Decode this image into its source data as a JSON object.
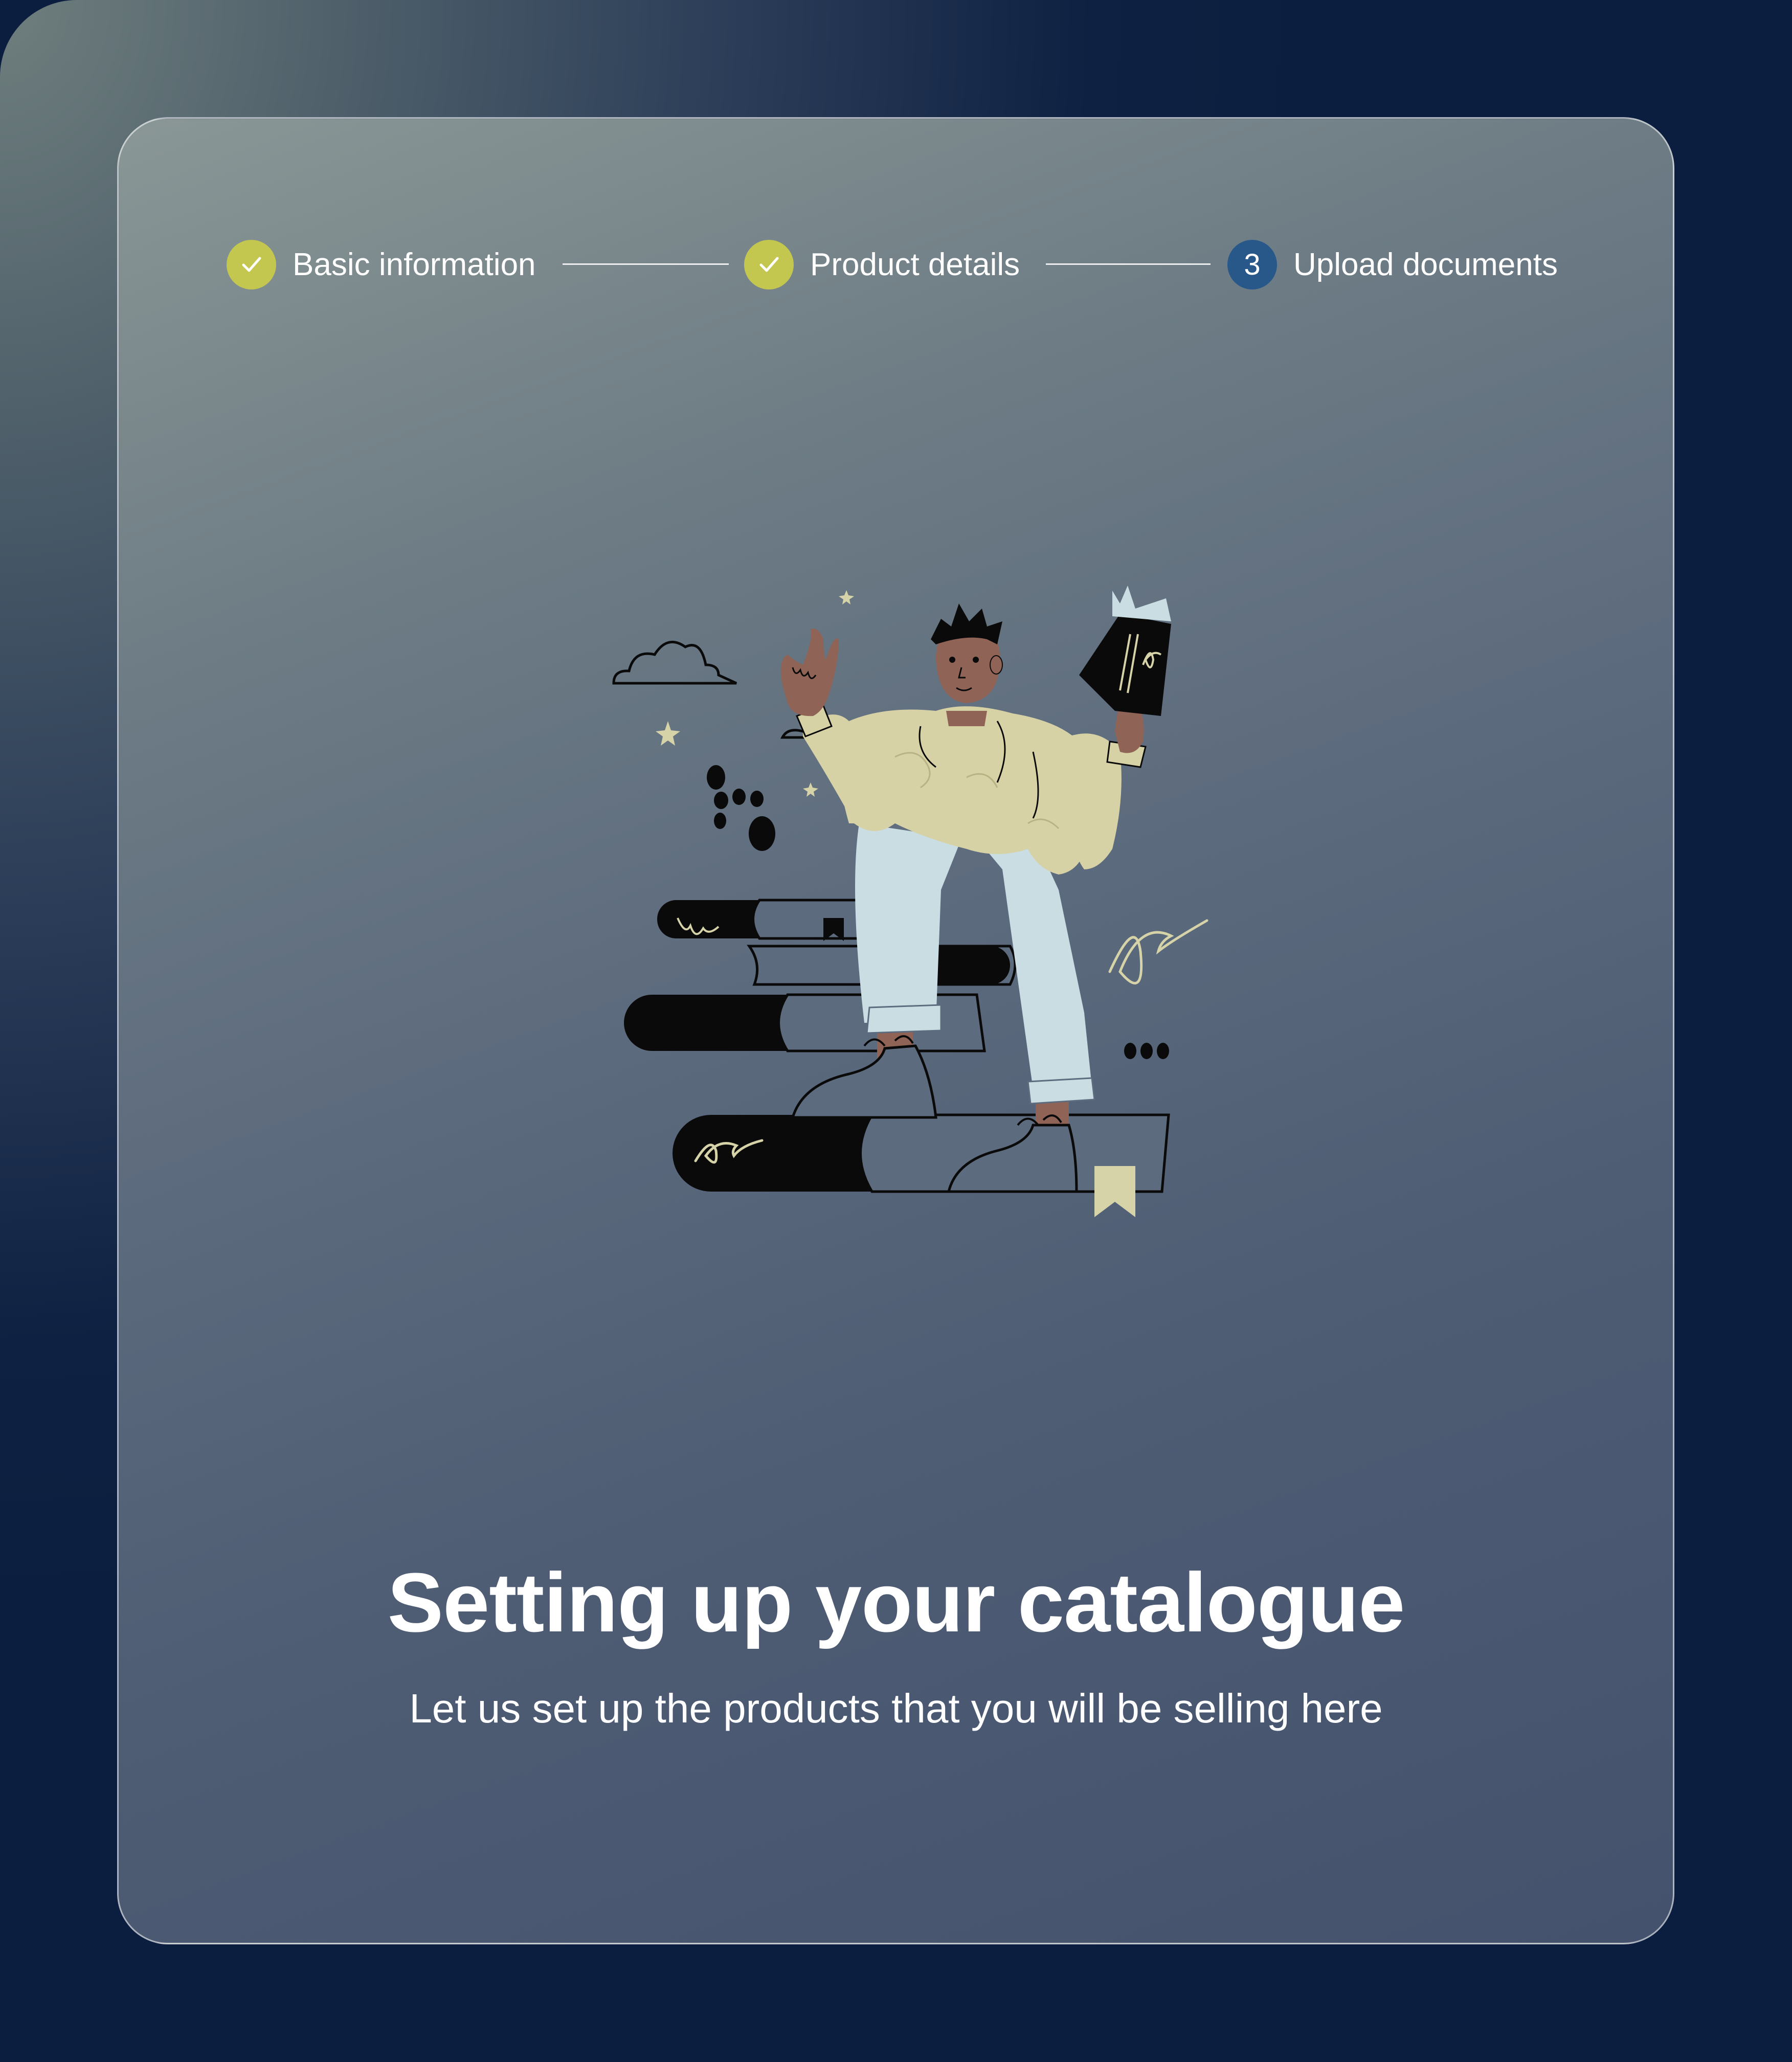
{
  "stepper": {
    "steps": [
      {
        "label": "Basic information",
        "status": "completed",
        "icon": "check-icon"
      },
      {
        "label": "Product details",
        "status": "completed",
        "icon": "check-icon"
      },
      {
        "label": "Upload documents",
        "status": "current",
        "number": "3"
      }
    ]
  },
  "main": {
    "title": "Setting up your catalogue",
    "subtitle": "Let us set up the products that you will be selling here",
    "illustration": "person-stepping-on-books-illustration"
  },
  "colors": {
    "completed_step": "#c3c64f",
    "current_step": "#28588a",
    "text": "#ffffff",
    "background_dark": "#0c1e3f"
  }
}
